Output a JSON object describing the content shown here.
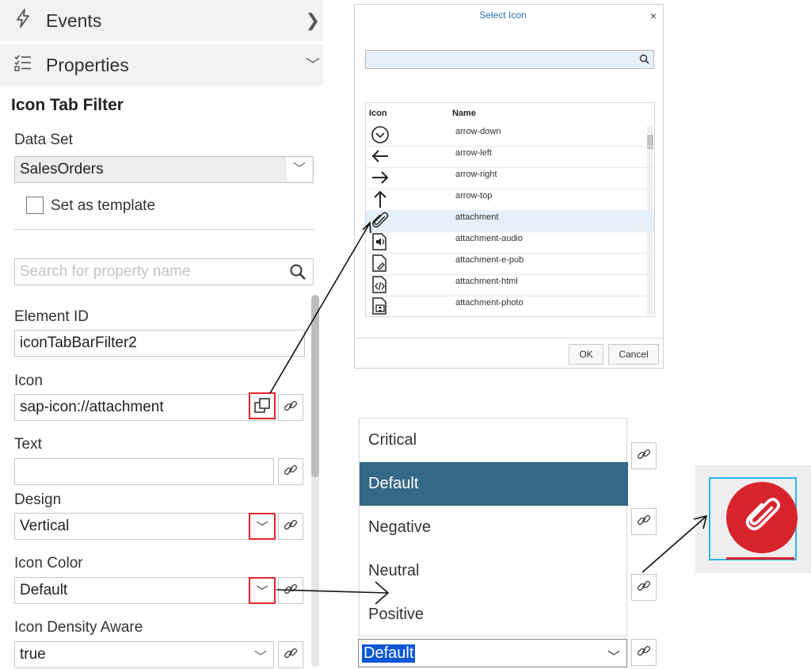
{
  "sidebar": {
    "events": {
      "label": "Events",
      "icon": "lightning-icon"
    },
    "properties": {
      "label": "Properties",
      "icon": "list-icon"
    }
  },
  "panel": {
    "title": "Icon Tab Filter",
    "data_set": {
      "label": "Data Set",
      "value": "SalesOrders"
    },
    "template_label": "Set as template",
    "search_placeholder": "Search for property name",
    "element_id": {
      "label": "Element ID",
      "value": "iconTabBarFilter2"
    },
    "icon": {
      "label": "Icon",
      "value": "sap-icon://attachment"
    },
    "text": {
      "label": "Text",
      "value": ""
    },
    "design": {
      "label": "Design",
      "value": "Vertical"
    },
    "icon_color": {
      "label": "Icon Color",
      "value": "Default"
    },
    "density": {
      "label": "Icon Density Aware",
      "value": "true"
    }
  },
  "dialog": {
    "title": "Select Icon",
    "close": "×",
    "col_icon": "Icon",
    "col_name": "Name",
    "rows": [
      {
        "name": "arrow-down",
        "icon": "arrow-down-circle-icon"
      },
      {
        "name": "arrow-left",
        "icon": "arrow-left-icon"
      },
      {
        "name": "arrow-right",
        "icon": "arrow-right-icon"
      },
      {
        "name": "arrow-top",
        "icon": "arrow-up-icon"
      },
      {
        "name": "attachment",
        "icon": "paperclip-icon"
      },
      {
        "name": "attachment-audio",
        "icon": "doc-audio-icon"
      },
      {
        "name": "attachment-e-pub",
        "icon": "doc-epub-icon"
      },
      {
        "name": "attachment-html",
        "icon": "doc-html-icon"
      },
      {
        "name": "attachment-photo",
        "icon": "doc-photo-icon"
      }
    ],
    "selected_row": "attachment",
    "ok": "OK",
    "cancel": "Cancel"
  },
  "color_list": {
    "options": [
      "Critical",
      "Default",
      "Negative",
      "Neutral",
      "Positive"
    ],
    "selected": "Default",
    "current_value": "Default"
  },
  "preview": {
    "icon": "paperclip-icon",
    "accent": "#d9232b"
  },
  "colors": {
    "selection": "#346887",
    "highlight_row": "#e5f0fa",
    "red_outline": "#e3262c",
    "preview_border": "#29b6e8"
  }
}
